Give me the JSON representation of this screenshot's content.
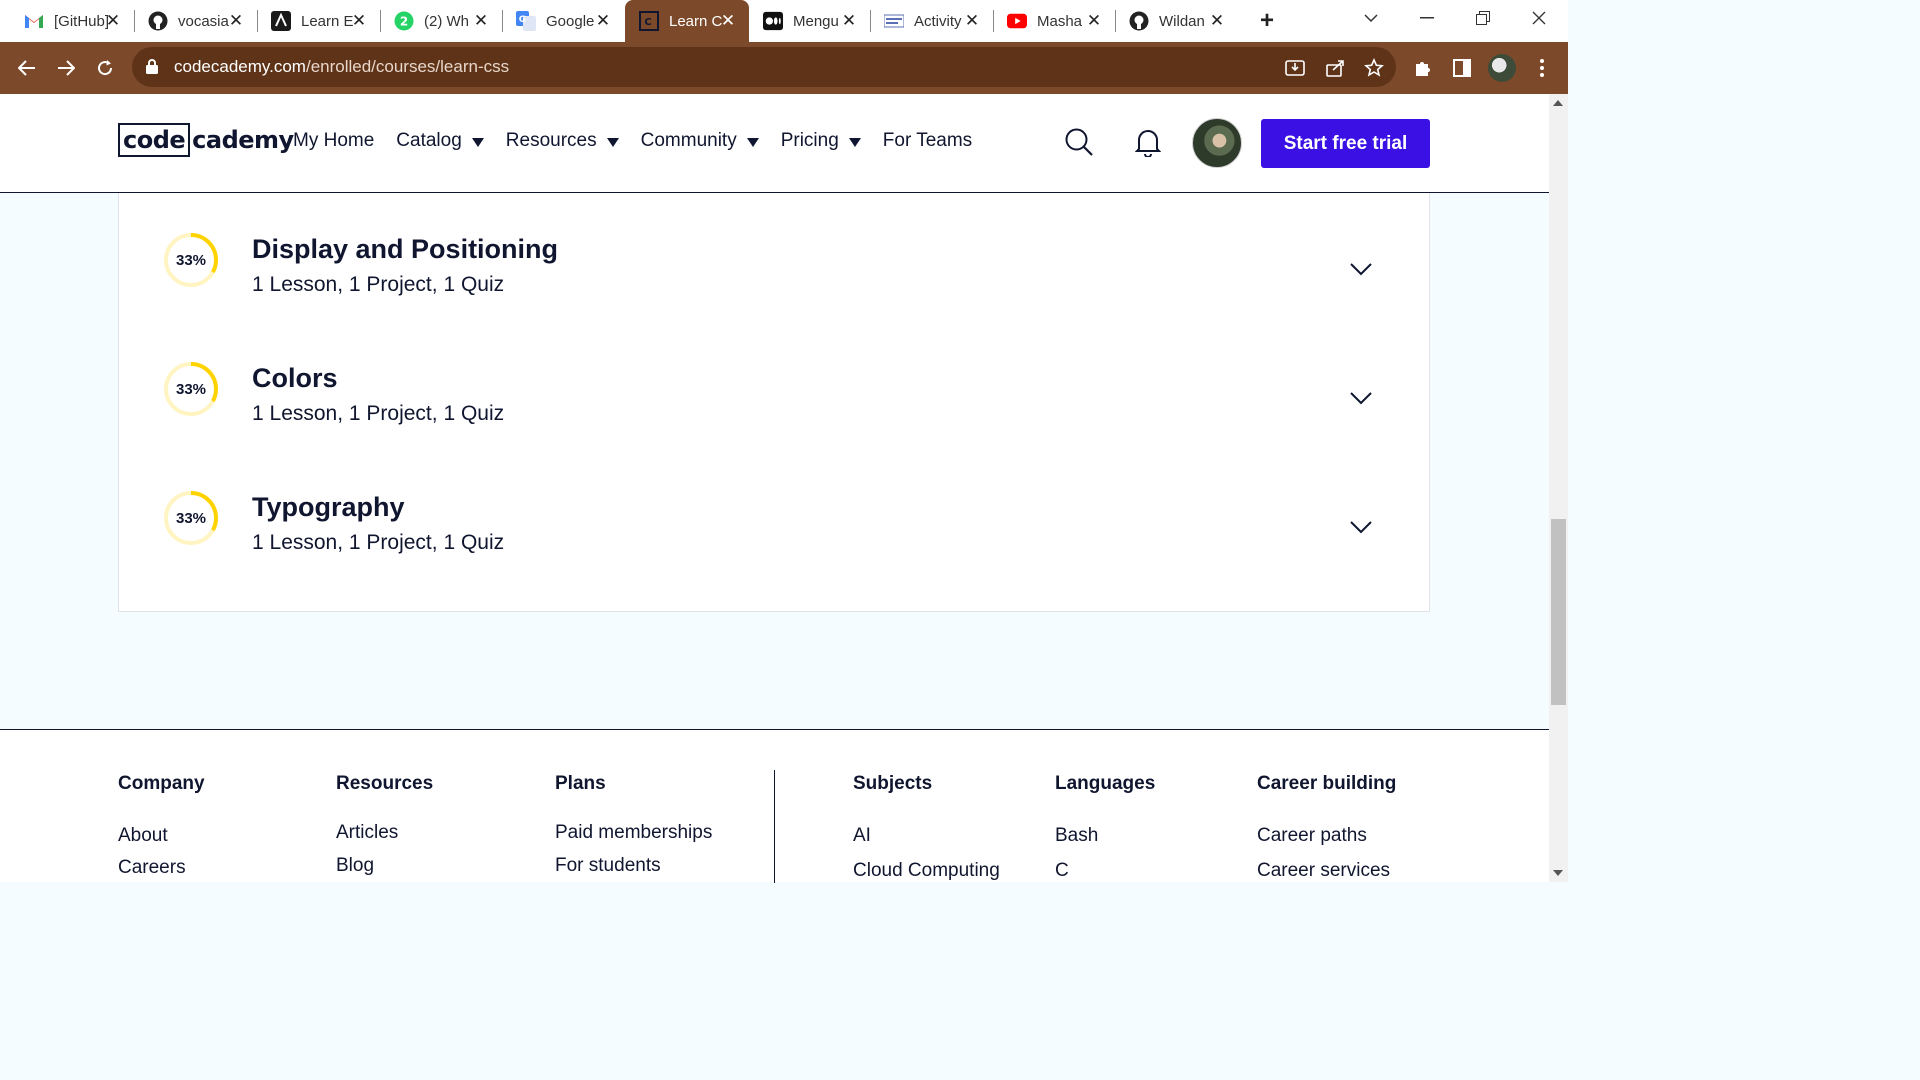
{
  "browser": {
    "tabs": [
      {
        "title": "[GitHub]",
        "icon": "gmail-icon",
        "active": false
      },
      {
        "title": "vocasia",
        "icon": "github-icon",
        "active": false
      },
      {
        "title": "Learn E",
        "icon": "web-app-icon",
        "active": false
      },
      {
        "title": "(2) Wh",
        "icon": "whatsapp-icon",
        "active": false
      },
      {
        "title": "Google",
        "icon": "google-translate-icon",
        "active": false
      },
      {
        "title": "Learn C",
        "icon": "codecademy-icon",
        "active": true
      },
      {
        "title": "Mengu",
        "icon": "medium-icon",
        "active": false
      },
      {
        "title": "Activity",
        "icon": "activity-icon",
        "active": false
      },
      {
        "title": "Masha",
        "icon": "youtube-icon",
        "active": false
      },
      {
        "title": "Wildan",
        "icon": "github-icon",
        "active": false
      }
    ],
    "url_domain": "codecademy.com",
    "url_path": "/enrolled/courses/learn-css",
    "toolbar_color": "#7c4a2a"
  },
  "header": {
    "logo_code": "code",
    "logo_rest": "cademy",
    "nav": [
      {
        "label": "My Home",
        "has_caret": false
      },
      {
        "label": "Catalog",
        "has_caret": true
      },
      {
        "label": "Resources",
        "has_caret": true
      },
      {
        "label": "Community",
        "has_caret": true
      },
      {
        "label": "Pricing",
        "has_caret": true
      },
      {
        "label": "For Teams",
        "has_caret": false
      }
    ],
    "cta_label": "Start free trial",
    "cta_color": "#3a10e5"
  },
  "modules": [
    {
      "title": "Display and Positioning",
      "meta": "1 Lesson, 1 Project, 1 Quiz",
      "progress_label": "33%",
      "progress": 0.33
    },
    {
      "title": "Colors",
      "meta": "1 Lesson, 1 Project, 1 Quiz",
      "progress_label": "33%",
      "progress": 0.33
    },
    {
      "title": "Typography",
      "meta": "1 Lesson, 1 Project, 1 Quiz",
      "progress_label": "33%",
      "progress": 0.33
    }
  ],
  "progress_color": "#ffd300",
  "footer": {
    "columns": [
      {
        "heading": "Company",
        "links": [
          "About",
          "Careers"
        ]
      },
      {
        "heading": "Resources",
        "links": [
          "Articles",
          "Blog"
        ]
      },
      {
        "heading": "Plans",
        "links": [
          "Paid memberships",
          "For students"
        ]
      },
      {
        "heading": "Subjects",
        "links": [
          "AI",
          "Cloud Computing"
        ]
      },
      {
        "heading": "Languages",
        "links": [
          "Bash",
          "C"
        ]
      },
      {
        "heading": "Career building",
        "links": [
          "Career paths",
          "Career services"
        ]
      }
    ]
  }
}
